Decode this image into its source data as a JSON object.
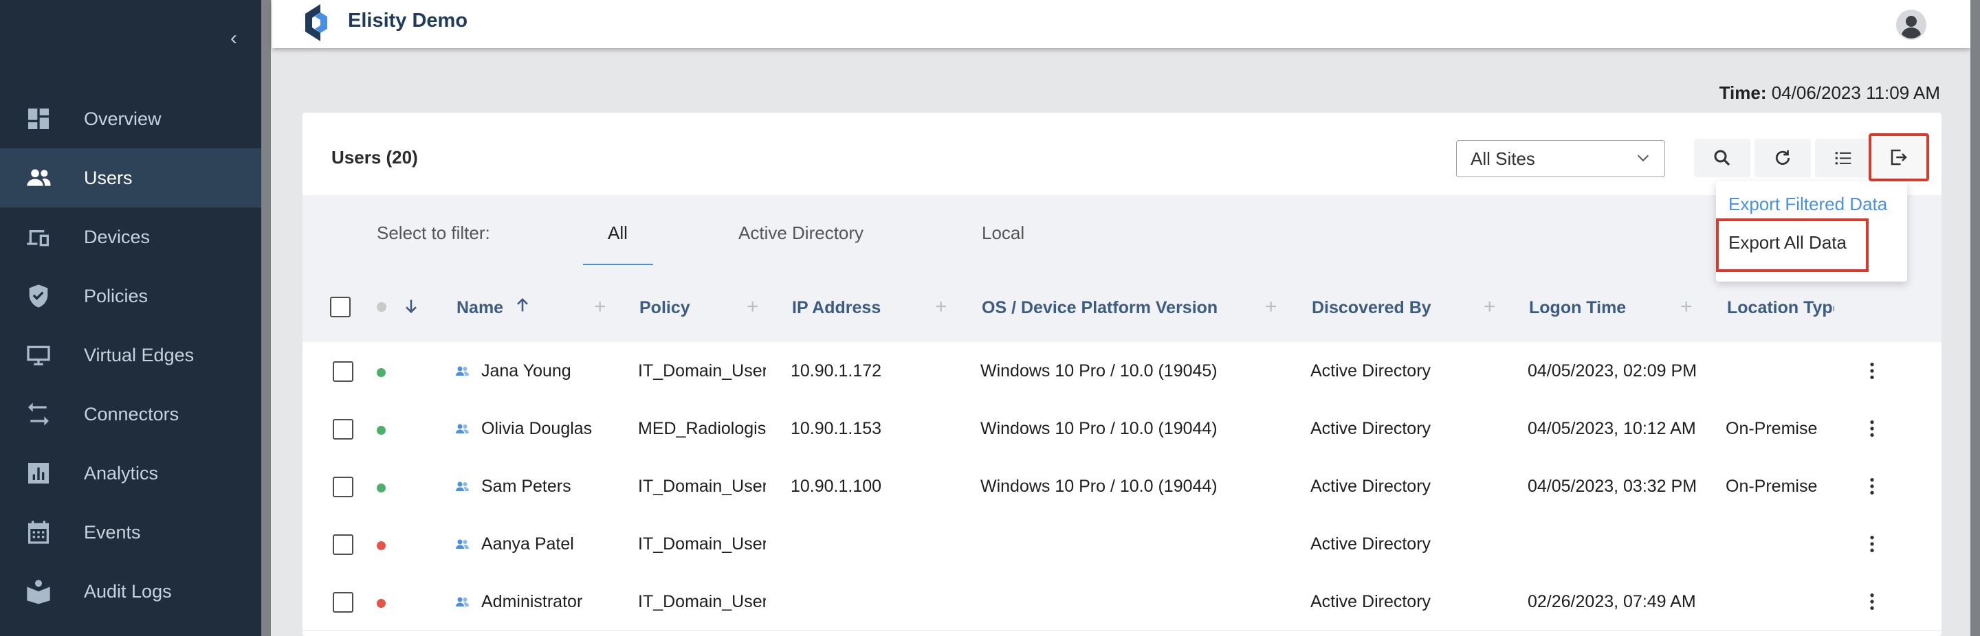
{
  "brand": {
    "name": "Elisity Demo"
  },
  "sidebar": {
    "collapse_glyph": "‹",
    "items": [
      {
        "label": "Overview",
        "icon": "dashboard-icon"
      },
      {
        "label": "Users",
        "icon": "users-icon",
        "active": true
      },
      {
        "label": "Devices",
        "icon": "devices-icon"
      },
      {
        "label": "Policies",
        "icon": "shield-icon"
      },
      {
        "label": "Virtual Edges",
        "icon": "monitor-icon"
      },
      {
        "label": "Connectors",
        "icon": "swap-arrows-icon"
      },
      {
        "label": "Analytics",
        "icon": "bar-chart-icon"
      },
      {
        "label": "Events",
        "icon": "calendar-icon"
      },
      {
        "label": "Audit Logs",
        "icon": "book-user-icon"
      }
    ]
  },
  "time": {
    "label": "Time:",
    "value": "04/06/2023 11:09 AM"
  },
  "card": {
    "title": "Users (20)",
    "site_select": "All Sites",
    "toolbar": [
      "search-icon",
      "refresh-icon",
      "list-icon",
      "export-icon"
    ]
  },
  "filter": {
    "label": "Select to filter:",
    "tabs": [
      "All",
      "Active Directory",
      "Local"
    ],
    "active_tab": "All"
  },
  "columns": [
    "Name",
    "Policy",
    "IP Address",
    "OS /  Device Platform Version",
    "Discovered By",
    "Logon Time",
    "Location Type"
  ],
  "rows": [
    {
      "status": "online",
      "name": "Jana Young",
      "policy": "IT_Domain_Users",
      "ip": "10.90.1.172",
      "os": "Windows 10 Pro / 10.0 (19045)",
      "discovered": "Active Directory",
      "logon": "04/05/2023, 02:09 PM",
      "location": ""
    },
    {
      "status": "online",
      "name": "Olivia Douglas",
      "policy": "MED_Radiologists",
      "ip": "10.90.1.153",
      "os": "Windows 10 Pro / 10.0 (19044)",
      "discovered": "Active Directory",
      "logon": "04/05/2023, 10:12 AM",
      "location": "On-Premise"
    },
    {
      "status": "online",
      "name": "Sam Peters",
      "policy": "IT_Domain_Users",
      "ip": "10.90.1.100",
      "os": "Windows 10 Pro / 10.0 (19044)",
      "discovered": "Active Directory",
      "logon": "04/05/2023, 03:32 PM",
      "location": "On-Premise"
    },
    {
      "status": "offline",
      "name": "Aanya Patel",
      "policy": "IT_Domain_Users",
      "ip": "",
      "os": "",
      "discovered": "Active Directory",
      "logon": "",
      "location": ""
    },
    {
      "status": "offline",
      "name": "Administrator",
      "policy": "IT_Domain_Users",
      "ip": "",
      "os": "",
      "discovered": "Active Directory",
      "logon": "02/26/2023, 07:49 AM",
      "location": ""
    }
  ],
  "export_menu": {
    "filtered": "Export Filtered Data",
    "all": "Export All Data"
  },
  "colors": {
    "sidebar_bg": "#1f2d3d",
    "accent": "#4a90e2",
    "highlight": "#d93a2b",
    "online": "#4caf6a",
    "offline": "#e5534b"
  }
}
